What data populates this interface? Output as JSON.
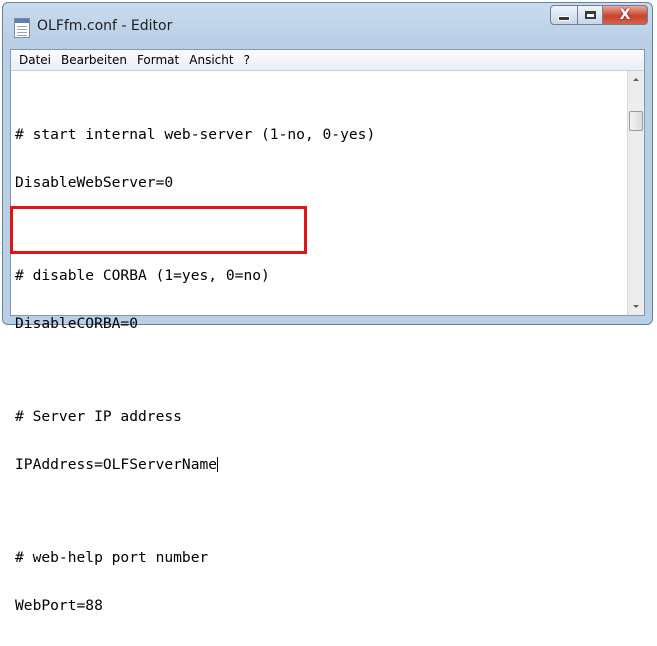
{
  "window": {
    "title": "OLFfm.conf - Editor",
    "icon": "notepad-icon",
    "caption_buttons": [
      {
        "name": "minimize",
        "icon": "minimize-icon"
      },
      {
        "name": "maximize",
        "icon": "maximize-icon"
      },
      {
        "name": "close",
        "icon": "close-icon",
        "glyph": "X"
      }
    ]
  },
  "menu": {
    "items": [
      "Datei",
      "Bearbeiten",
      "Format",
      "Ansicht",
      "?"
    ]
  },
  "editor": {
    "lines": [
      "# start internal web-server (1-no, 0-yes)",
      "DisableWebServer=0",
      "",
      "# disable CORBA (1=yes, 0=no)",
      "DisableCORBA=0",
      "",
      "# Server IP address",
      "IPAddress=OLFServerName",
      "",
      "# web-help port number",
      "WebPort=88"
    ]
  },
  "colors": {
    "highlight_border": "#e01414",
    "close_button": "#c84330",
    "titlebar": "#b9cfe6"
  }
}
